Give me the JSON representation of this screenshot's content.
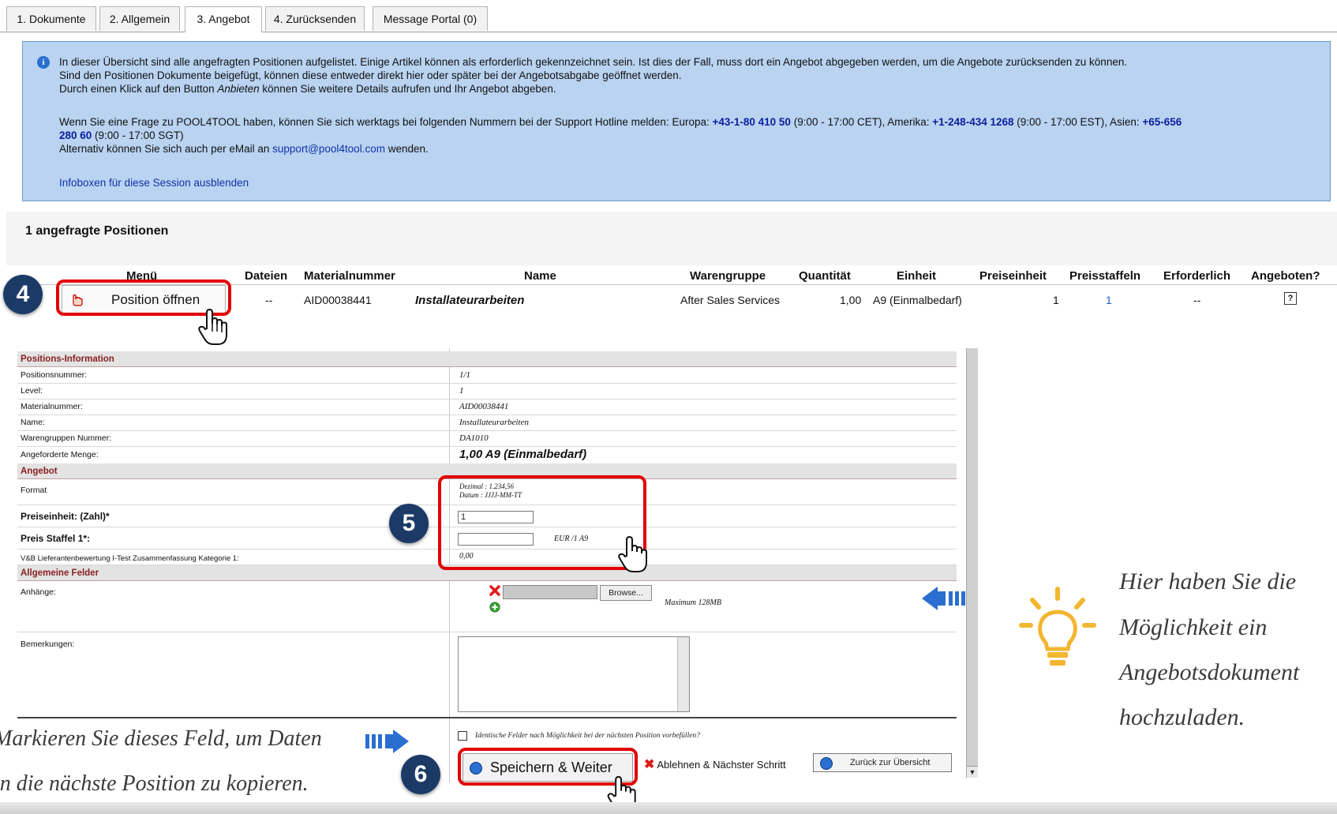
{
  "tabs": [
    "1. Dokumente",
    "2. Allgemein",
    "3. Angebot",
    "4. Zurücksenden",
    "Message Portal (0)"
  ],
  "info": {
    "line1": "In dieser Übersicht sind alle angefragten Positionen aufgelistet. Einige Artikel können als erforderlich gekennzeichnet sein. Ist dies der Fall, muss dort ein Angebot abgegeben werden, um die Angebote zurücksenden zu können.",
    "line2": "Sind den Positionen Dokumente beigefügt, können diese entweder direkt hier oder später bei der Angebotsabgabe geöffnet werden.",
    "line3_a": "Durch einen Klick auf den Button ",
    "line3_em": "Anbieten",
    "line3_b": " können Sie weitere Details aufrufen und Ihr Angebot abgeben.",
    "support_a": "Wenn Sie eine Frage zu POOL4TOOL haben, können Sie sich werktags bei folgenden Nummern bei der Support Hotline melden: Europa: ",
    "europe_num": "+43-1-80 410 50",
    "europe_time": " (9:00 - 17:00 CET), Amerika: ",
    "america_num": "+1-248-434 1268",
    "america_time": " (9:00 - 17:00 EST), Asien: ",
    "asia_num_1": "+65-656",
    "asia_num_2": "280 60",
    "asia_time": " (9:00 - 17:00 SGT)",
    "mail_a": "Alternativ können Sie sich auch per eMail an ",
    "mail": "support@pool4tool.com",
    "mail_b": " wenden.",
    "hide_link": "Infoboxen für diese Session ausblenden"
  },
  "positions": {
    "title": "1 angefragte Positionen",
    "headers": {
      "menu": "Menü",
      "files": "Dateien",
      "material": "Materialnummer",
      "name": "Name",
      "group": "Warengruppe",
      "qty": "Quantität",
      "unit": "Einheit",
      "price_unit": "Preiseinheit",
      "tiers": "Preisstaffeln",
      "required": "Erforderlich",
      "offered": "Angeboten?"
    },
    "row": {
      "open_button": "Position öffnen",
      "files": "--",
      "material": "AID00038441",
      "name": "Installateurarbeiten",
      "group": "After Sales Services",
      "qty": "1,00",
      "unit": "A9 (Einmalbedarf)",
      "price_unit": "1",
      "tiers": "1",
      "required": "--",
      "offered": "?"
    }
  },
  "form": {
    "sections": {
      "info": "Positions-Information",
      "offer": "Angebot",
      "general": "Allgemeine Felder"
    },
    "fields": {
      "pos_nr_label": "Positionsnummer:",
      "pos_nr": "1/1",
      "level_label": "Level:",
      "level": "1",
      "material_label": "Materialnummer:",
      "material": "AID00038441",
      "name_label": "Name:",
      "name": "Installateurarbeiten",
      "group_label": "Warengruppen Nummer:",
      "group": "DA1010",
      "qty_label": "Angeforderte Menge:",
      "qty": "1,00 A9 (Einmalbedarf)",
      "format_label": "Format",
      "format_dec_label": "Dezimal : ",
      "format_dec": "1.234,56",
      "format_date_label": "Datum : ",
      "format_date": "JJJJ-MM-TT",
      "price_unit_label": "Preiseinheit: (Zahl)*",
      "price_unit_value": "1",
      "tier_label": "Preis Staffel 1*:",
      "tier_value": "",
      "tier_unit": "EUR /1 A9",
      "vb_label": "V&B Lieferantenbewertung I-Test Zusammenfassung Kategorie 1:",
      "vb_value": "0,00",
      "attach_label": "Anhänge:",
      "browse": "Browse...",
      "max": "Maximum 128MB",
      "remarks_label": "Bemerkungen:",
      "prefill": "Identische Felder nach Möglichkeit bei der nächsten Position vorbefüllen?"
    },
    "buttons": {
      "save": "Speichern & Weiter",
      "reject": "Ablehnen & Nächster Schritt",
      "back": "Zurück zur Übersicht"
    }
  },
  "annotations": {
    "badge4": "4",
    "badge5": "5",
    "badge6": "6",
    "tip_lines": [
      "Hier haben Sie die",
      "Möglichkeit ein",
      "Angebotsdokument",
      "hochzuladen."
    ],
    "note_line1": "Markieren Sie dieses Feld, um Daten",
    "note_line2": "in die nächste Position zu kopieren."
  },
  "colors": {
    "highlight": "#e10000",
    "badge": "#1c3a66",
    "infobox": "#b9d3f1",
    "lightbulb": "#f2b630",
    "arrow": "#2a6fd0"
  }
}
